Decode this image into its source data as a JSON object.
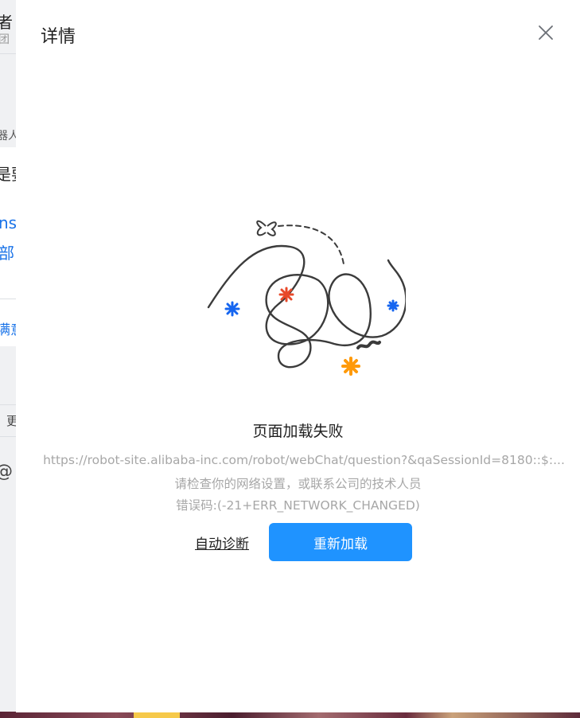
{
  "background": {
    "fragments": [
      "者",
      "团",
      "器人",
      "是要",
      "ns",
      "部",
      "满意",
      "更",
      "@"
    ]
  },
  "dialog": {
    "title": "详情",
    "close_icon": "close-icon"
  },
  "error": {
    "illustration": "tangled-line-illustration",
    "title": "页面加载失败",
    "url": "https://robot-site.alibaba-inc.com/robot/webChat/question?&qaSessionId=8180::$:...",
    "hint": "请检查你的网络设置，或联系公司的技术人员",
    "code": "错误码:(-21+ERR_NETWORK_CHANGED)"
  },
  "actions": {
    "diagnose_label": "自动诊断",
    "reload_label": "重新加载"
  },
  "colors": {
    "primary": "#1f93ff",
    "accent_red": "#e8492a",
    "accent_orange": "#ff9a0a",
    "accent_blue": "#1565f0"
  }
}
